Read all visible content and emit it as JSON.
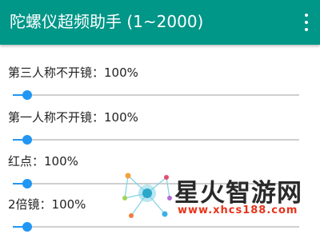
{
  "colors": {
    "primary": "#009688",
    "accent": "#2196f3"
  },
  "appbar": {
    "title": "陀螺仪超频助手 (1~2000)",
    "menu_icon": "overflow-menu-icon"
  },
  "settings": [
    {
      "label": "第三人称不开镜：100%",
      "value": 100,
      "max": 2000
    },
    {
      "label": "第一人称不开镜：100%",
      "value": 100,
      "max": 2000
    },
    {
      "label": "红点：100%",
      "value": 100,
      "max": 2000
    },
    {
      "label": "2倍镜：100%",
      "value": 100,
      "max": 2000
    }
  ],
  "watermark": {
    "brand": "星火智游网",
    "site": "www.xhcs188.com"
  }
}
